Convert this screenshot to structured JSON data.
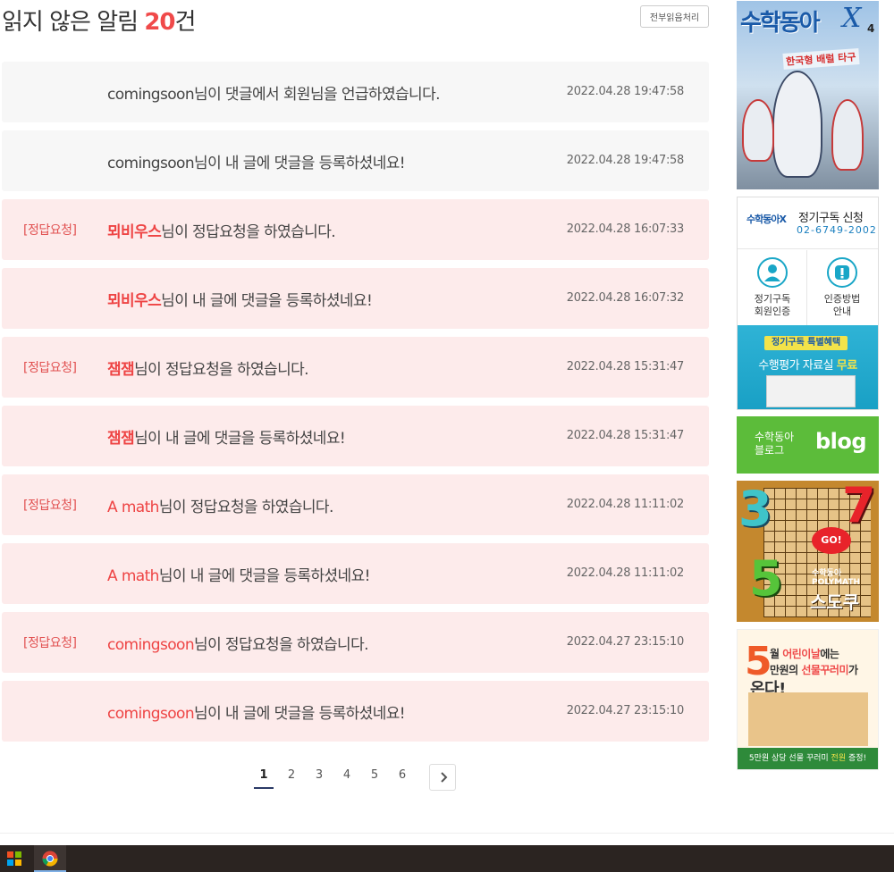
{
  "header": {
    "title_prefix": "읽지 않은 알림",
    "unread_count": "20",
    "title_suffix": "건",
    "mark_all_label": "전부읽음처리"
  },
  "notifications": [
    {
      "tag": "",
      "who": "comingsoon",
      "rest": "님이 댓글에서 회원님을 언급하였습니다.",
      "date": "2022.04.28 19:47:58",
      "unread": false
    },
    {
      "tag": "",
      "who": "comingsoon",
      "rest": "님이 내 글에 댓글을 등록하셨네요!",
      "date": "2022.04.28 19:47:58",
      "unread": false
    },
    {
      "tag": "[정답요청]",
      "who": "뫼비우스",
      "rest": "님이 정답요청을 하였습니다.",
      "date": "2022.04.28 16:07:33",
      "unread": true
    },
    {
      "tag": "",
      "who": "뫼비우스",
      "rest": "님이 내 글에 댓글을 등록하셨네요!",
      "date": "2022.04.28 16:07:32",
      "unread": true
    },
    {
      "tag": "[정답요청]",
      "who": "잼잼",
      "rest": "님이 정답요청을 하였습니다.",
      "date": "2022.04.28 15:31:47",
      "unread": true
    },
    {
      "tag": "",
      "who": "잼잼",
      "rest": "님이 내 글에 댓글을 등록하셨네요!",
      "date": "2022.04.28 15:31:47",
      "unread": true
    },
    {
      "tag": "[정답요청]",
      "who": "A math",
      "rest": "님이 정답요청을 하였습니다.",
      "date": "2022.04.28 11:11:02",
      "unread": true
    },
    {
      "tag": "",
      "who": "A math",
      "rest": "님이 내 글에 댓글을 등록하셨네요!",
      "date": "2022.04.28 11:11:02",
      "unread": true
    },
    {
      "tag": "[정답요청]",
      "who": "comingsoon",
      "rest": "님이 정답요청을 하였습니다.",
      "date": "2022.04.27 23:15:10",
      "unread": true
    },
    {
      "tag": "",
      "who": "comingsoon",
      "rest": "님이 내 글에 댓글을 등록하셨네요!",
      "date": "2022.04.27 23:15:10",
      "unread": true
    }
  ],
  "pagination": {
    "pages": [
      "1",
      "2",
      "3",
      "4",
      "5",
      "6"
    ],
    "current": "1",
    "next_icon": "chevron-right-icon"
  },
  "sidebar": {
    "cover": {
      "title": "수학동아",
      "x": "X",
      "issue": "4",
      "headline": "한국형 배럴 타구"
    },
    "subscription": {
      "logo": "수학동아X",
      "title": "정기구독 신청",
      "phone": "02-6749-2002",
      "left_label_1": "정기구독",
      "left_label_2": "회원인증",
      "right_label_1": "인증방법",
      "right_label_2": "안내",
      "promo_tag": "정기구독 특별혜택",
      "promo_text": "수행평가 자료실",
      "promo_highlight": "무료"
    },
    "blog": {
      "kr_1": "수학동아",
      "kr_2": "블로그",
      "en": "blog"
    },
    "sudoku": {
      "go": "GO!",
      "brand_1": "수학동아",
      "brand_2": "POLYMATH",
      "title": "스도쿠",
      "n1": "3",
      "n2": "7",
      "n3": "5"
    },
    "event": {
      "num": "5",
      "line1_a": "월 ",
      "line1_hl": "어린이날",
      "line1_b": "에는",
      "line2_a": "만원의 ",
      "line2_hl": "선물꾸러미",
      "line2_b": "가",
      "line3": "온다!",
      "footer_a": "5만원 상당 선물 꾸러미 ",
      "footer_hl": "전원",
      "footer_b": " 증정!"
    }
  },
  "taskbar": {
    "start_icon": "windows-icon",
    "app_icon": "chrome-icon"
  },
  "colors": {
    "accent": "#f04a4a",
    "unread_bg": "#fdebeb",
    "read_bg": "#f7f7f7"
  }
}
